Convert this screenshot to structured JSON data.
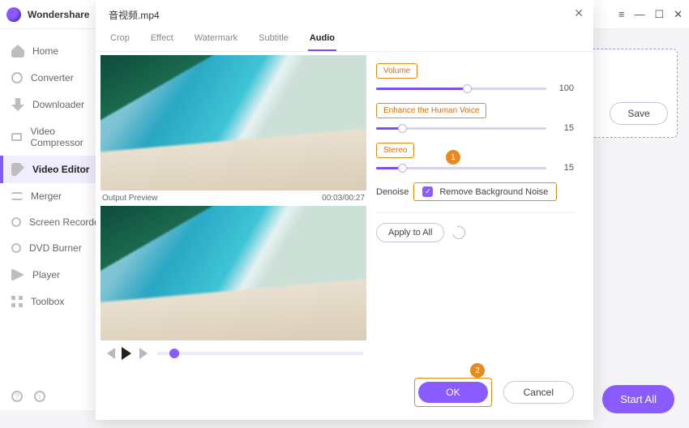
{
  "app": {
    "brand": "Wondershare "
  },
  "sidebar": {
    "items": [
      {
        "label": "Home"
      },
      {
        "label": "Converter"
      },
      {
        "label": "Downloader"
      },
      {
        "label": "Video Compressor"
      },
      {
        "label": "Video Editor"
      },
      {
        "label": "Merger"
      },
      {
        "label": "Screen Recorder"
      },
      {
        "label": "DVD Burner"
      },
      {
        "label": "Player"
      },
      {
        "label": "Toolbox"
      }
    ]
  },
  "backpanel": {
    "save": "Save",
    "start_all": "Start All"
  },
  "modal": {
    "title": "音视频.mp4",
    "tabs": [
      {
        "label": "Crop"
      },
      {
        "label": "Effect"
      },
      {
        "label": "Watermark"
      },
      {
        "label": "Subtitle"
      },
      {
        "label": "Audio"
      }
    ],
    "preview_label": "Output Preview",
    "time": "00:03/00:27",
    "audio": {
      "volume_label": "Volume",
      "volume_value": "100",
      "enhance_label": "Enhance the Human Voice",
      "enhance_value": "15",
      "stereo_label": "Stereo",
      "stereo_value": "15",
      "denoise_label": "Denoise",
      "remove_noise_label": "Remove Background Noise",
      "apply_label": "Apply to All"
    },
    "badge1": "1",
    "badge2": "2",
    "ok": "OK",
    "cancel": "Cancel"
  }
}
